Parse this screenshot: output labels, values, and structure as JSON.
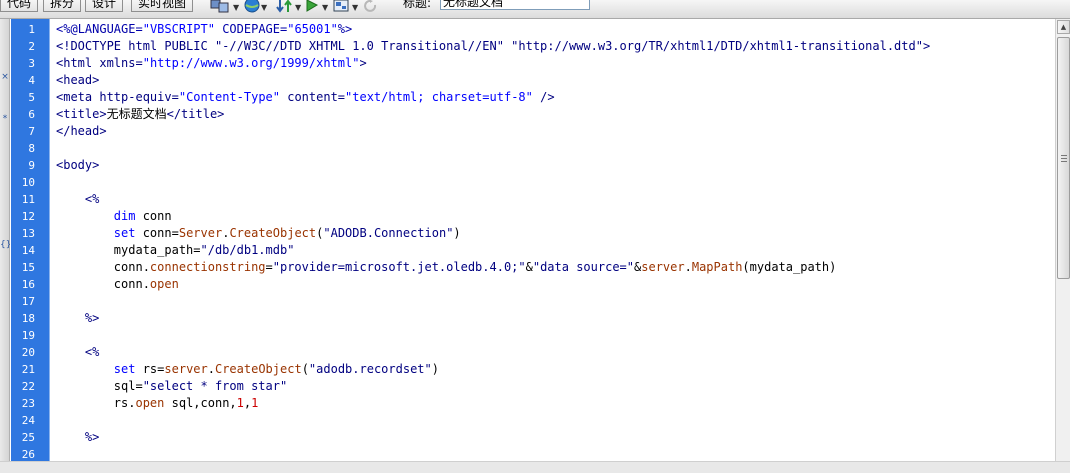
{
  "toolbar": {
    "view_buttons": [
      "代码",
      "拆分",
      "设计",
      "实时视图"
    ],
    "title_label": "标题:",
    "title_value": "无标题文档",
    "icons": [
      "multiscreen-icon",
      "globe-icon",
      "file-transfer-icon",
      "preview-icon",
      "visual-aids-icon",
      "refresh-icon"
    ]
  },
  "left_toolbar": {
    "glyphs": [
      "",
      "",
      "×",
      "",
      "*",
      "",
      "",
      "",
      "",
      "",
      "{}",
      "",
      "",
      "",
      "",
      "",
      "",
      "",
      "",
      "",
      ""
    ]
  },
  "editor": {
    "line_numbers": [
      "1",
      "2",
      "3",
      "4",
      "5",
      "6",
      "7",
      "8",
      "9",
      "10",
      "11",
      "12",
      "13",
      "14",
      "15",
      "16",
      "17",
      "18",
      "19",
      "20",
      "21",
      "22",
      "23",
      "24",
      "25",
      "26"
    ],
    "lines": [
      [
        {
          "t": "<%@",
          "c": "dir"
        },
        {
          "t": "LANGUAGE=",
          "c": "dir"
        },
        {
          "t": "\"VBSCRIPT\"",
          "c": "val"
        },
        {
          "t": " CODEPAGE=",
          "c": "dir"
        },
        {
          "t": "\"65001\"",
          "c": "val"
        },
        {
          "t": "%>",
          "c": "dir"
        }
      ],
      [
        {
          "t": "<!DOCTYPE html PUBLIC \"-//W3C//DTD XHTML 1.0 Transitional//EN\" \"http://www.w3.org/TR/xhtml1/DTD/xhtml1-transitional.dtd\">",
          "c": "tag"
        }
      ],
      [
        {
          "t": "<html ",
          "c": "tag"
        },
        {
          "t": "xmlns=",
          "c": "attr"
        },
        {
          "t": "\"http://www.w3.org/1999/xhtml\"",
          "c": "val"
        },
        {
          "t": ">",
          "c": "tag"
        }
      ],
      [
        {
          "t": "<head>",
          "c": "tag"
        }
      ],
      [
        {
          "t": "<meta ",
          "c": "tag"
        },
        {
          "t": "http-equiv=",
          "c": "attr"
        },
        {
          "t": "\"Content-Type\"",
          "c": "val"
        },
        {
          "t": " content=",
          "c": "attr"
        },
        {
          "t": "\"text/html; charset=utf-8\"",
          "c": "val"
        },
        {
          "t": " />",
          "c": "tag"
        }
      ],
      [
        {
          "t": "<title>",
          "c": "tag"
        },
        {
          "t": "无标题文档",
          "c": "cn"
        },
        {
          "t": "</title>",
          "c": "tag"
        }
      ],
      [
        {
          "t": "</head>",
          "c": "tag"
        }
      ],
      [],
      [
        {
          "t": "<body>",
          "c": "tag"
        }
      ],
      [],
      [
        {
          "t": "    <%",
          "c": "tag"
        }
      ],
      [
        {
          "t": "        ",
          "c": "plain"
        },
        {
          "t": "dim",
          "c": "kw"
        },
        {
          "t": " conn",
          "c": "plain"
        }
      ],
      [
        {
          "t": "        ",
          "c": "plain"
        },
        {
          "t": "set",
          "c": "kw"
        },
        {
          "t": " conn=",
          "c": "plain"
        },
        {
          "t": "Server",
          "c": "obj"
        },
        {
          "t": ".",
          "c": "plain"
        },
        {
          "t": "CreateObject",
          "c": "obj"
        },
        {
          "t": "(",
          "c": "plain"
        },
        {
          "t": "\"ADODB.Connection\"",
          "c": "str"
        },
        {
          "t": ")",
          "c": "plain"
        }
      ],
      [
        {
          "t": "        mydata_path=",
          "c": "plain"
        },
        {
          "t": "\"/db/db1.mdb\"",
          "c": "str"
        }
      ],
      [
        {
          "t": "        conn.",
          "c": "plain"
        },
        {
          "t": "connectionstring",
          "c": "obj"
        },
        {
          "t": "=",
          "c": "plain"
        },
        {
          "t": "\"provider=microsoft.jet.oledb.4.0;\"",
          "c": "str"
        },
        {
          "t": "&",
          "c": "plain"
        },
        {
          "t": "\"data source=\"",
          "c": "str"
        },
        {
          "t": "&",
          "c": "plain"
        },
        {
          "t": "server",
          "c": "obj"
        },
        {
          "t": ".",
          "c": "plain"
        },
        {
          "t": "MapPath",
          "c": "obj"
        },
        {
          "t": "(mydata_path)",
          "c": "plain"
        }
      ],
      [
        {
          "t": "        conn.",
          "c": "plain"
        },
        {
          "t": "open",
          "c": "obj"
        }
      ],
      [],
      [
        {
          "t": "    %>",
          "c": "tag"
        }
      ],
      [],
      [
        {
          "t": "    <%",
          "c": "tag"
        }
      ],
      [
        {
          "t": "        ",
          "c": "plain"
        },
        {
          "t": "set",
          "c": "kw"
        },
        {
          "t": " rs=",
          "c": "plain"
        },
        {
          "t": "server",
          "c": "obj"
        },
        {
          "t": ".",
          "c": "plain"
        },
        {
          "t": "CreateObject",
          "c": "obj"
        },
        {
          "t": "(",
          "c": "plain"
        },
        {
          "t": "\"adodb.recordset\"",
          "c": "str"
        },
        {
          "t": ")",
          "c": "plain"
        }
      ],
      [
        {
          "t": "        sql=",
          "c": "plain"
        },
        {
          "t": "\"select * from star\"",
          "c": "str"
        }
      ],
      [
        {
          "t": "        rs.",
          "c": "plain"
        },
        {
          "t": "open",
          "c": "obj"
        },
        {
          "t": " sql,conn,",
          "c": "plain"
        },
        {
          "t": "1",
          "c": "num"
        },
        {
          "t": ",",
          "c": "plain"
        },
        {
          "t": "1",
          "c": "num"
        }
      ],
      [],
      [
        {
          "t": "    %>",
          "c": "tag"
        }
      ],
      []
    ]
  }
}
